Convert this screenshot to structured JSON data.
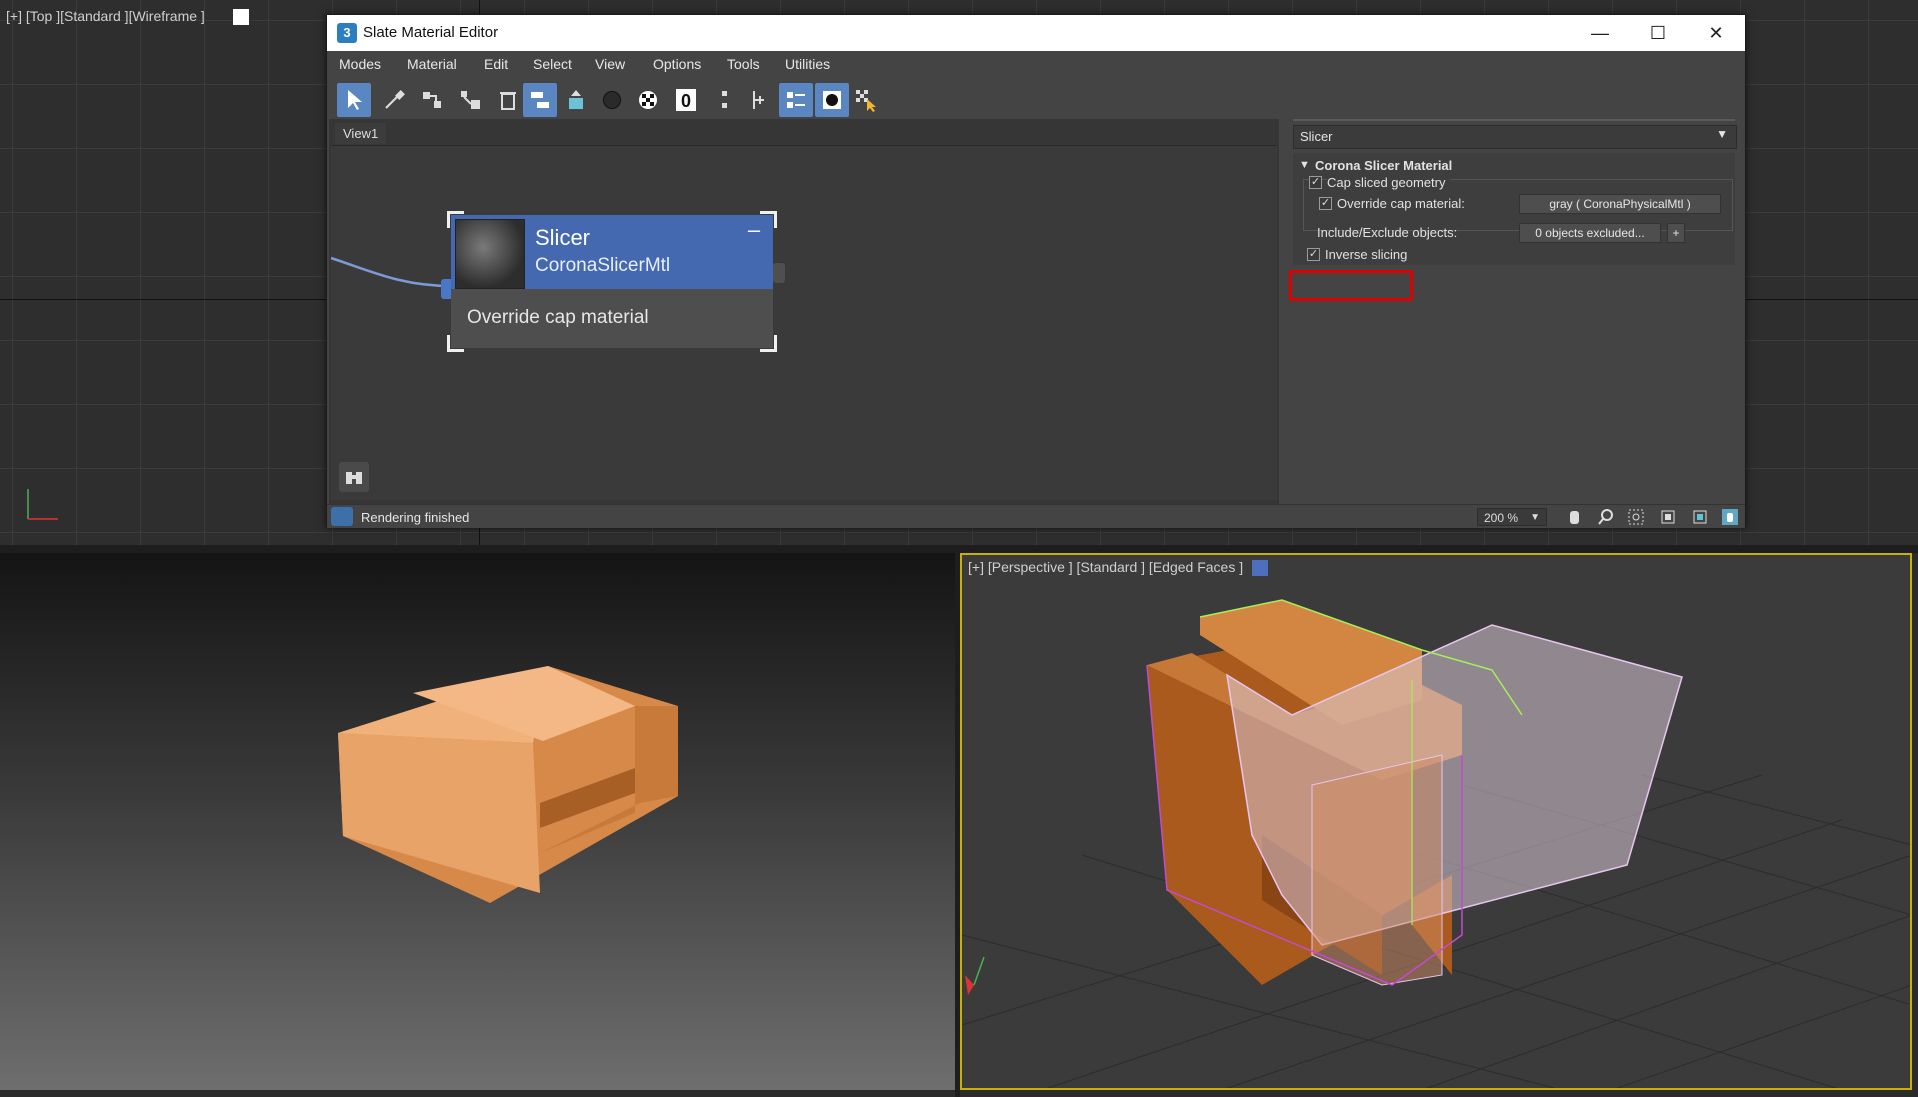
{
  "viewports": {
    "top_label": "[+] [Top ][Standard ][Wireframe ]",
    "persp_label": "[+] [Perspective ] [Standard ] [Edged Faces ]"
  },
  "window": {
    "title": "Slate Material Editor",
    "icon_text": "3",
    "menu": [
      "Modes",
      "Material",
      "Edit",
      "Select",
      "View",
      "Options",
      "Tools",
      "Utilities"
    ],
    "view_tab": "View1",
    "node": {
      "name": "Slicer",
      "type": "CoronaSlicerMtl",
      "slot": "Override cap material"
    },
    "params": {
      "material_name": "Slicer",
      "rollout_title": "Corona Slicer Material",
      "cap_sliced_geometry": {
        "label": "Cap sliced geometry",
        "checked": true
      },
      "override_cap": {
        "label": "Override cap material:",
        "checked": true,
        "value": "gray  (  CoronaPhysicalMtl )"
      },
      "include_exclude": {
        "label": "Include/Exclude objects:",
        "value": "0 objects excluded...",
        "plus": "+"
      },
      "inverse_slicing": {
        "label": "Inverse slicing",
        "checked": true
      }
    },
    "status": "Rendering finished",
    "zoom": "200 %"
  },
  "colors": {
    "accent": "#4469b0",
    "highlight": "#e00000",
    "viewport_active": "#c9b100",
    "object_orange": "#d98a46"
  }
}
